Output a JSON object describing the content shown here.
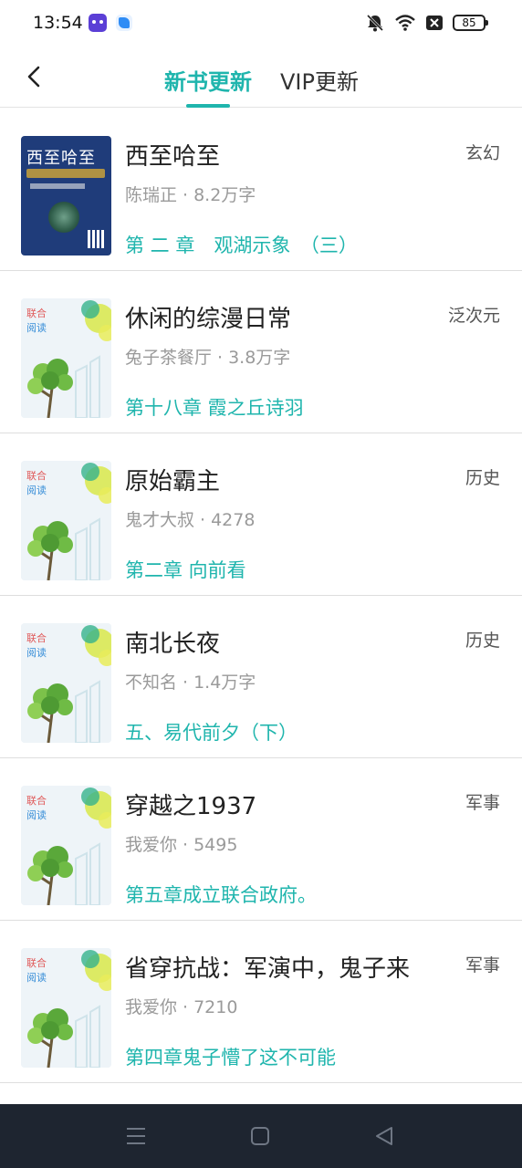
{
  "status_bar": {
    "time": "13:54",
    "battery": "85"
  },
  "nav": {
    "tabs": [
      {
        "label": "新书更新",
        "active": true
      },
      {
        "label": "VIP更新",
        "active": false
      }
    ]
  },
  "books": [
    {
      "title": "西至哈至",
      "author": "陈瑞正",
      "size": "8.2万字",
      "chapter": "第 二 章　观湖示象　（三）",
      "genre": "玄幻",
      "cover": "real",
      "cover_text": "西至哈至"
    },
    {
      "title": "休闲的综漫日常",
      "author": "兔子茶餐厅",
      "size": "3.8万字",
      "chapter": "第十八章 霞之丘诗羽",
      "genre": "泛次元",
      "cover": "tree"
    },
    {
      "title": "原始霸主",
      "author": "鬼才大叔",
      "size": "4278",
      "chapter": "第二章 向前看",
      "genre": "历史",
      "cover": "tree"
    },
    {
      "title": "南北长夜",
      "author": "不知名",
      "size": "1.4万字",
      "chapter": "五、易代前夕（下）",
      "genre": "历史",
      "cover": "tree"
    },
    {
      "title": "穿越之1937",
      "author": "我爱你",
      "size": "5495",
      "chapter": "第五章成立联合政府。",
      "genre": "军事",
      "cover": "tree"
    },
    {
      "title": "省穿抗战：军演中，鬼子来",
      "author": "我爱你",
      "size": "7210",
      "chapter": "第四章鬼子懵了这不可能",
      "genre": "军事",
      "cover": "tree"
    }
  ],
  "cover_labels": {
    "line1": "联合",
    "line2": "阅读"
  },
  "colors": {
    "accent": "#1fb5ad",
    "bottom_bar": "#1e2530"
  },
  "icons": [
    "back-arrow-icon",
    "mute-icon",
    "wifi-icon",
    "no-sim-icon",
    "battery-icon",
    "menu-icon",
    "home-icon",
    "back-triangle-icon"
  ]
}
